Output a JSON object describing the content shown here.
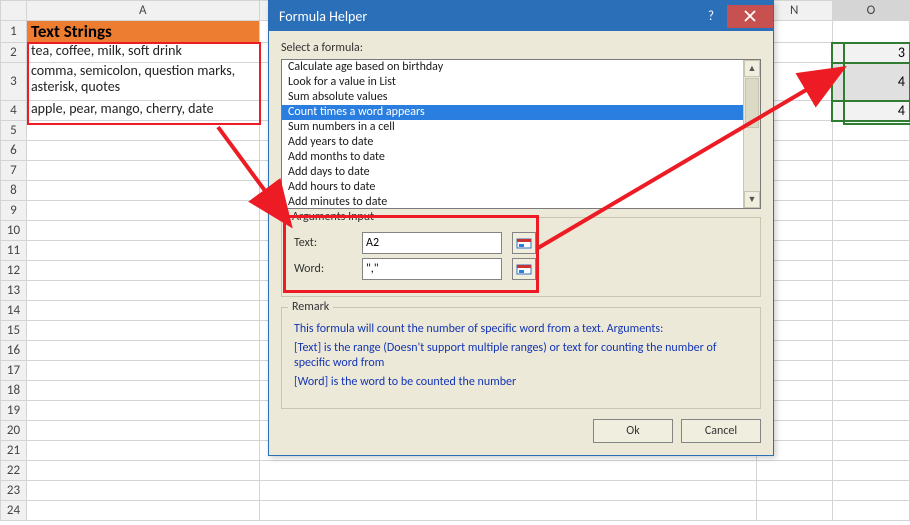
{
  "sheet": {
    "col_headers": {
      "A": "A",
      "N": "N",
      "O": "O"
    },
    "rows": [
      {
        "num": "1",
        "A": "Text Strings",
        "N": "",
        "O": ""
      },
      {
        "num": "2",
        "A": "tea, coffee, milk, soft drink",
        "N": "",
        "O": "3"
      },
      {
        "num": "3",
        "A": "comma, semicolon, question marks, asterisk, quotes",
        "N": "",
        "O": "4"
      },
      {
        "num": "4",
        "A": "apple, pear, mango, cherry, date",
        "N": "",
        "O": "4"
      },
      {
        "num": "5"
      },
      {
        "num": "6"
      },
      {
        "num": "7"
      },
      {
        "num": "8"
      },
      {
        "num": "9"
      },
      {
        "num": "10"
      },
      {
        "num": "11"
      },
      {
        "num": "12"
      },
      {
        "num": "13"
      },
      {
        "num": "14"
      },
      {
        "num": "15"
      },
      {
        "num": "16"
      },
      {
        "num": "17"
      },
      {
        "num": "18"
      },
      {
        "num": "19"
      },
      {
        "num": "20"
      },
      {
        "num": "21"
      },
      {
        "num": "22"
      },
      {
        "num": "23"
      },
      {
        "num": "24"
      }
    ]
  },
  "dialog": {
    "title": "Formula Helper",
    "select_label": "Select a formula:",
    "formulas": [
      "Calculate age based on birthday",
      "Look for a value in List",
      "Sum absolute values",
      "Count times a word appears",
      "Sum numbers in a cell",
      "Add years to date",
      "Add months to date",
      "Add days to date",
      "Add hours to date",
      "Add minutes to date"
    ],
    "selected_index": 3,
    "args_legend": "Arguments Input",
    "text_lbl": "Text:",
    "text_val": "A2",
    "word_lbl": "Word:",
    "word_val": "\",\"",
    "remark_legend": "Remark",
    "remark_line1": "This formula will count the number of specific word from a text. Arguments:",
    "remark_line2": "[Text] is the range (Doesn't support multiple ranges) or text for counting the number of specific word from",
    "remark_line3": "[Word] is the word to be counted the number",
    "ok": "Ok",
    "cancel": "Cancel"
  }
}
